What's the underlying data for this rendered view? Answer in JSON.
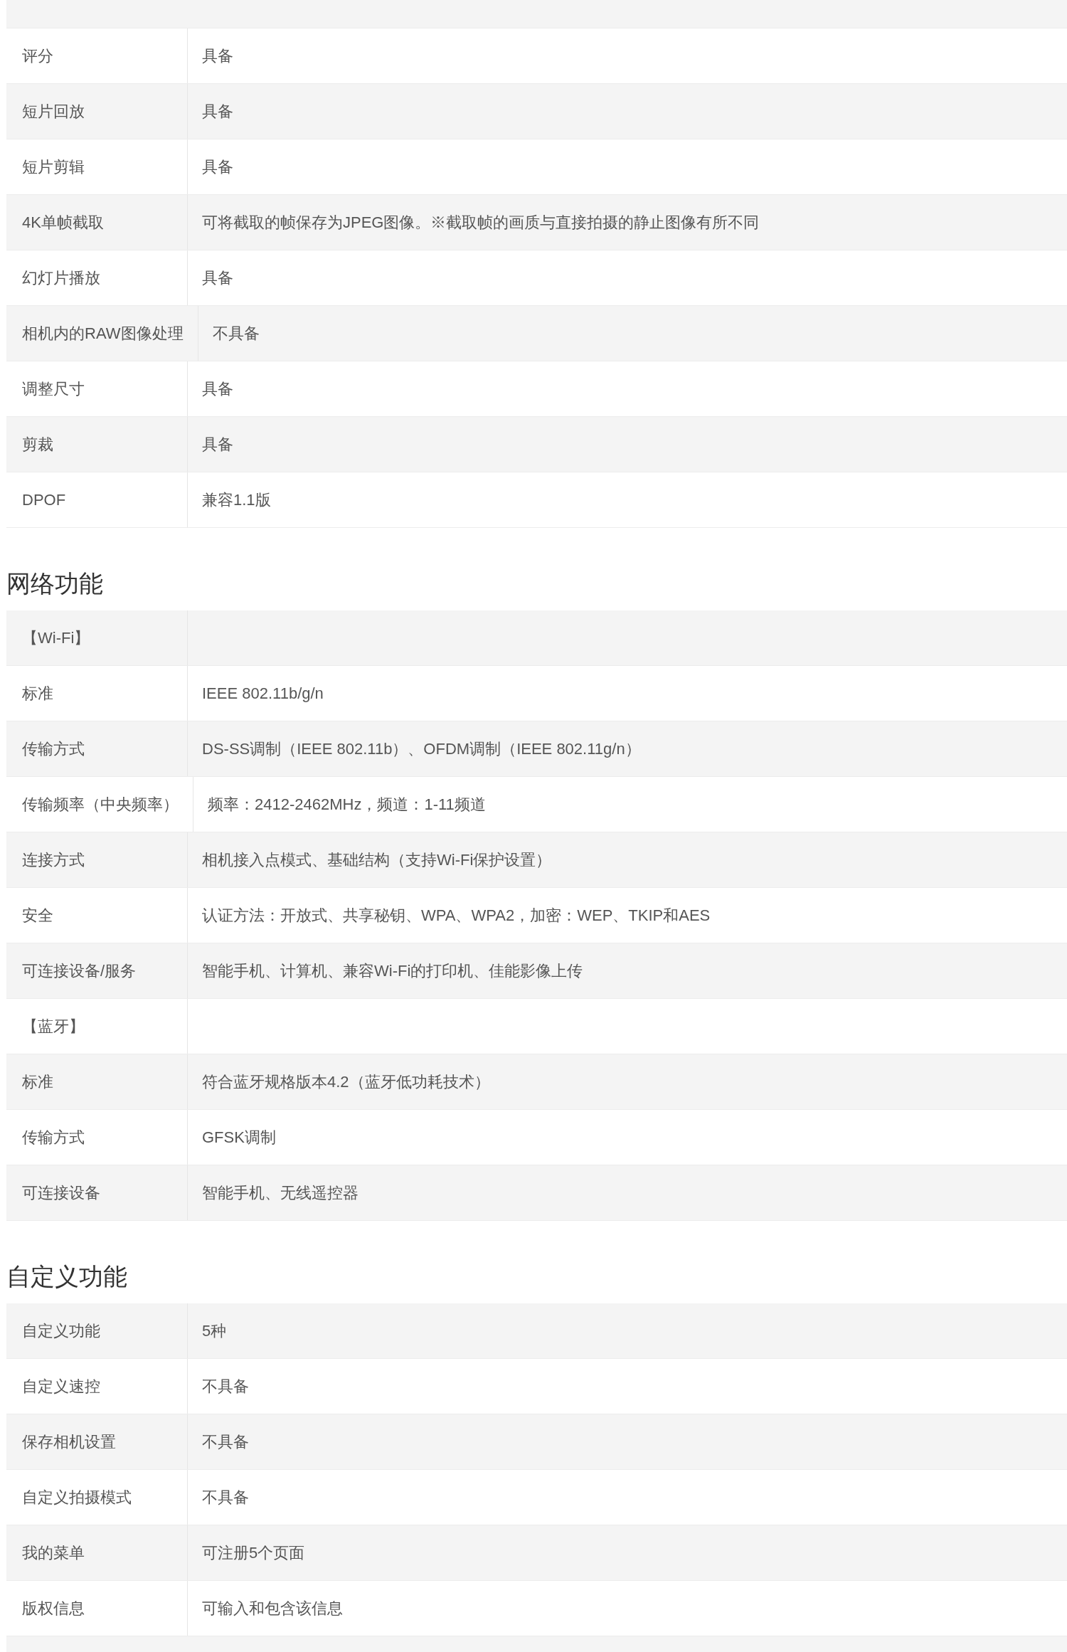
{
  "sections": [
    {
      "rows": [
        {
          "label": "评分",
          "value": "具备"
        },
        {
          "label": "短片回放",
          "value": "具备"
        },
        {
          "label": "短片剪辑",
          "value": "具备"
        },
        {
          "label": "4K单帧截取",
          "value": "可将截取的帧保存为JPEG图像。※截取帧的画质与直接拍摄的静止图像有所不同"
        },
        {
          "label": "幻灯片播放",
          "value": "具备"
        },
        {
          "label": "相机内的RAW图像处理",
          "value": "不具备"
        },
        {
          "label": "调整尺寸",
          "value": "具备"
        },
        {
          "label": "剪裁",
          "value": "具备"
        },
        {
          "label": "DPOF",
          "value": "兼容1.1版"
        }
      ]
    },
    {
      "title": "网络功能",
      "rows": [
        {
          "label": "【Wi-Fi】"
        },
        {
          "label": "标准",
          "value": "IEEE 802.11b/g/n"
        },
        {
          "label": "传输方式",
          "value": "DS-SS调制（IEEE 802.11b）、OFDM调制（IEEE 802.11g/n）"
        },
        {
          "label": "传输频率（中央频率）",
          "value": "频率：2412-2462MHz，频道：1-11频道"
        },
        {
          "label": "连接方式",
          "value": "相机接入点模式、基础结构（支持Wi-Fi保护设置）"
        },
        {
          "label": "安全",
          "value": "认证方法：开放式、共享秘钥、WPA、WPA2，加密：WEP、TKIP和AES"
        },
        {
          "label": "可连接设备/服务",
          "value": "智能手机、计算机、兼容Wi-Fi的打印机、佳能影像上传"
        },
        {
          "label": "【蓝牙】"
        },
        {
          "label": "标准",
          "value": "符合蓝牙规格版本4.2（蓝牙低功耗技术）"
        },
        {
          "label": "传输方式",
          "value": "GFSK调制"
        },
        {
          "label": "可连接设备",
          "value": "智能手机、无线遥控器"
        }
      ]
    },
    {
      "title": "自定义功能",
      "rows": [
        {
          "label": "自定义功能",
          "value": "5种"
        },
        {
          "label": "自定义速控",
          "value": "不具备"
        },
        {
          "label": "保存相机设置",
          "value": "不具备"
        },
        {
          "label": "自定义拍摄模式",
          "value": "不具备"
        },
        {
          "label": "我的菜单",
          "value": "可注册5个页面"
        },
        {
          "label": "版权信息",
          "value": "可输入和包含该信息"
        }
      ]
    }
  ]
}
